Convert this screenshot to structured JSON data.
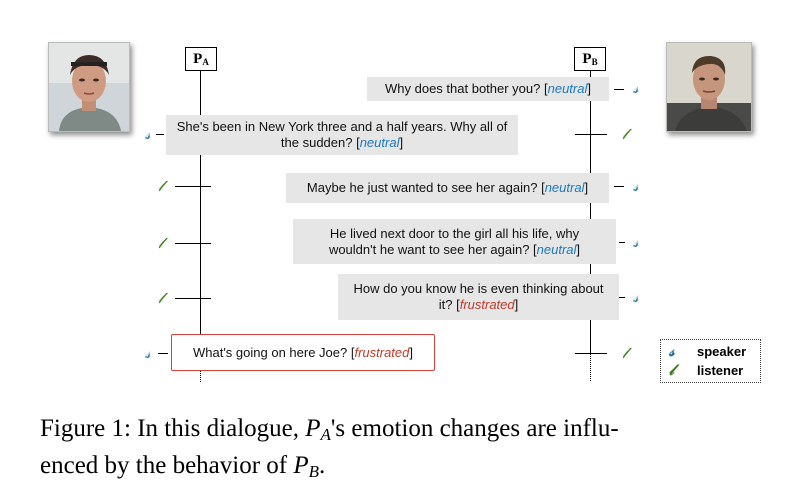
{
  "participants": {
    "a": {
      "label_main": "P",
      "label_sub": "A"
    },
    "b": {
      "label_main": "P",
      "label_sub": "B"
    }
  },
  "utterances": [
    {
      "speaker": "B",
      "text": "Why does that bother you? [",
      "emotion": "neutral",
      "close": "]"
    },
    {
      "speaker": "A",
      "text_line1": "She's been in New York three and a half years. Why all of",
      "text_line2": "the sudden? [",
      "emotion": "neutral",
      "close": "]"
    },
    {
      "speaker": "B",
      "text": "Maybe he just wanted to see her again? [",
      "emotion": "neutral",
      "close": "]"
    },
    {
      "speaker": "B",
      "text_line1": "He lived next door to the girl all his life, why",
      "text_line2": "wouldn't he want to see her again? [",
      "emotion": "neutral",
      "close": "]"
    },
    {
      "speaker": "B",
      "text_line1": "How do you know he is even thinking about",
      "text_line2": "it? [",
      "emotion": "frustrated",
      "close": "]"
    },
    {
      "speaker": "A",
      "text": "What's going on here Joe? [",
      "emotion": "frustrated",
      "close": "]"
    }
  ],
  "legend": {
    "speaker": "speaker",
    "listener": "listener"
  },
  "colors": {
    "neutral": "#1a78c2",
    "frustrated": "#c0392b",
    "highlight_border": "#d9403a",
    "bubble": "#e6e6e6"
  },
  "caption": {
    "prefix": "Figure 1: In this dialogue,",
    "line1_after": "'s emotion changes are influ-",
    "line2_before": "enced by the behavior of",
    "line2_after": ".",
    "pa_main": "P",
    "pa_sub": "A",
    "pb_main": "P",
    "pb_sub": "B"
  }
}
